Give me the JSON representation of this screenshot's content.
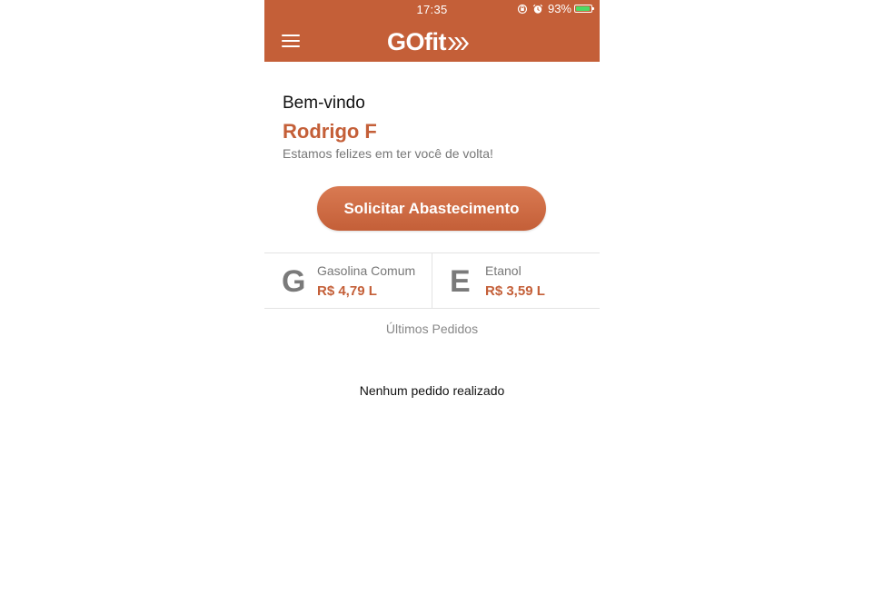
{
  "status_bar": {
    "time": "17:35",
    "battery": "93%",
    "battery_level": 0.93
  },
  "header": {
    "logo": "GOfit"
  },
  "welcome": {
    "greeting": "Bem-vindo",
    "name": "Rodrigo F",
    "subtitle": "Estamos felizes em ter você de volta!"
  },
  "cta": {
    "label": "Solicitar Abastecimento"
  },
  "fuels": [
    {
      "letter": "G",
      "name": "Gasolina Comum",
      "price": "R$ 4,79 L"
    },
    {
      "letter": "E",
      "name": "Etanol",
      "price": "R$ 3,59 L"
    }
  ],
  "orders": {
    "title": "Últimos Pedidos",
    "empty_text": "Nenhum pedido realizado"
  },
  "colors": {
    "brand": "#c45f38",
    "brand_light": "#d97a52"
  }
}
